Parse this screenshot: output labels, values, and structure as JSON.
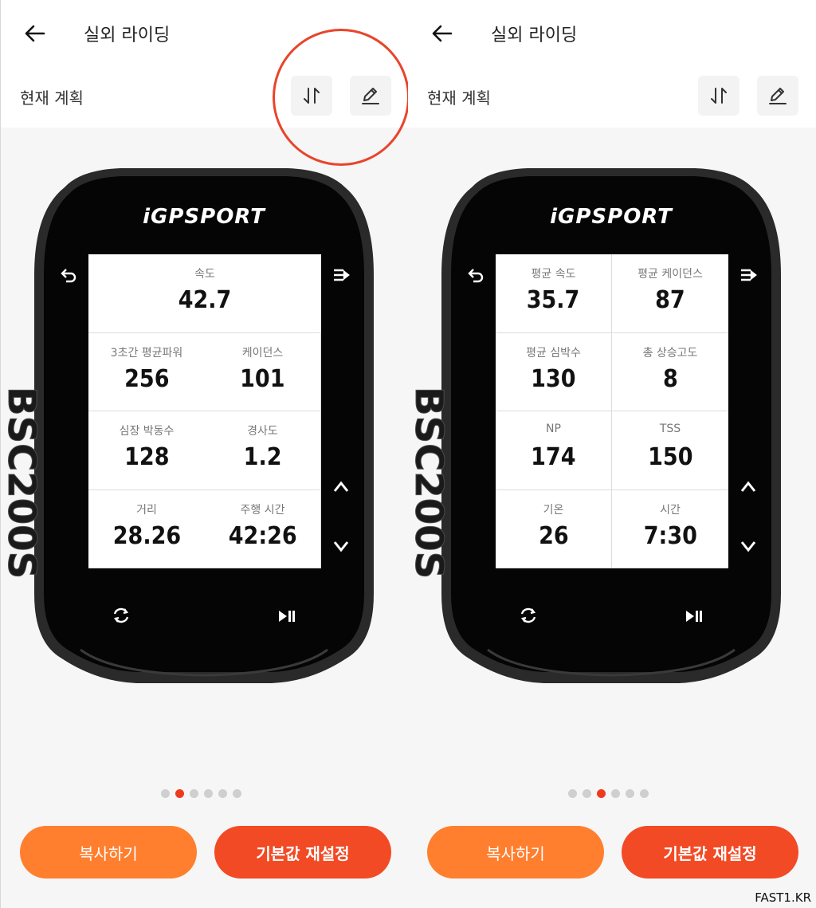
{
  "header": {
    "title": "실외 라이딩",
    "subtitle": "현재 계획"
  },
  "device": {
    "brand": "iGPSPORT",
    "model": "BSC200S"
  },
  "left": {
    "fields": [
      {
        "label": "속도",
        "value": "42.7"
      },
      {
        "label": "3초간 평균파워",
        "value": "256"
      },
      {
        "label": "케이던스",
        "value": "101"
      },
      {
        "label": "심장 박동수",
        "value": "128"
      },
      {
        "label": "경사도",
        "value": "1.2"
      },
      {
        "label": "거리",
        "value": "28.26"
      },
      {
        "label": "주행 시간",
        "value": "42:26"
      }
    ],
    "active_page": 2
  },
  "right": {
    "fields": [
      {
        "label": "평균 속도",
        "value": "35.7"
      },
      {
        "label": "평균 케이던스",
        "value": "87"
      },
      {
        "label": "평균 심박수",
        "value": "130"
      },
      {
        "label": "총 상승고도",
        "value": "8"
      },
      {
        "label": "NP",
        "value": "174"
      },
      {
        "label": "TSS",
        "value": "150"
      },
      {
        "label": "기온",
        "value": "26"
      },
      {
        "label": "시간",
        "value": "7:30"
      }
    ],
    "active_page": 3
  },
  "pagination": {
    "total": 6
  },
  "actions": {
    "copy": "복사하기",
    "reset": "기본값 재설정"
  },
  "watermark": "FAST1.KR",
  "colors": {
    "accent": "#f24a24",
    "copy": "#ff7f2f",
    "highlight_circle": "#e8452b"
  }
}
